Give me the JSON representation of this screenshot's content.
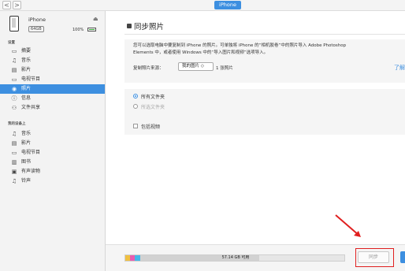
{
  "topbar": {
    "back": "<",
    "forward": ">",
    "device_label": "iPhone"
  },
  "device": {
    "name": "iPhone",
    "capacity": "64GB",
    "battery": "100%",
    "eject": "⏏"
  },
  "sidebar": {
    "settings_title": "设置",
    "settings_items": [
      {
        "icon": "▭",
        "label": "摘要"
      },
      {
        "icon": "♫",
        "label": "音乐"
      },
      {
        "icon": "▤",
        "label": "影片"
      },
      {
        "icon": "▭",
        "label": "电视节目"
      },
      {
        "icon": "◉",
        "label": "照片"
      },
      {
        "icon": "ⓘ",
        "label": "信息"
      },
      {
        "icon": "⚇",
        "label": "文件共享"
      }
    ],
    "ondevice_title": "我的设备上",
    "ondevice_items": [
      {
        "icon": "♫",
        "label": "音乐"
      },
      {
        "icon": "▤",
        "label": "影片"
      },
      {
        "icon": "▭",
        "label": "电视节目"
      },
      {
        "icon": "▥",
        "label": "图书"
      },
      {
        "icon": "▣",
        "label": "有声读物"
      },
      {
        "icon": "♫",
        "label": "铃声"
      }
    ]
  },
  "main": {
    "title": "同步照片",
    "description_line1": "您可以选取电脑中要复制到 iPhone 的照片。可单独将 iPhone 的“相机胶卷”中的照片导入 Adobe Photoshop",
    "description_line2": "Elements 中，或者使用 Windows 中的“导入图片和视频”选项导入。",
    "copy_label": "复制照片来源：",
    "copy_source": "我的图片 ◇",
    "copy_count": "1 张照片",
    "more_link": "了解",
    "option_all": "所有文件夹",
    "option_selected": "所选文件夹",
    "include_videos": "包括视频"
  },
  "bottom": {
    "storage_text": "57.14 GB 可用",
    "sync_label": "同步"
  },
  "colors": {
    "accent": "#3d8fe0",
    "highlight_box": "#e02020"
  }
}
